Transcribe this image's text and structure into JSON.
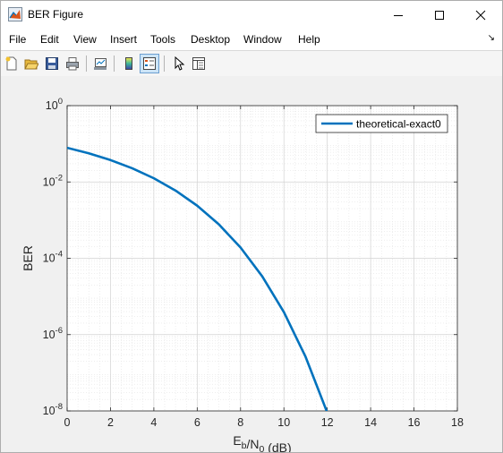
{
  "window": {
    "title": "BER Figure"
  },
  "menu": [
    "File",
    "Edit",
    "View",
    "Insert",
    "Tools",
    "Desktop",
    "Window",
    "Help"
  ],
  "toolbar": {
    "buttons": [
      {
        "icon": "new-figure-icon"
      },
      {
        "icon": "open-file-icon"
      },
      {
        "icon": "save-icon"
      },
      {
        "icon": "print-icon"
      },
      {
        "icon": "link-plot-icon"
      },
      {
        "icon": "colorbar-icon"
      },
      {
        "icon": "legend-icon",
        "pressed": true
      },
      {
        "icon": "pointer-icon"
      },
      {
        "icon": "property-inspector-icon"
      }
    ]
  },
  "chart_data": {
    "type": "line",
    "title": "",
    "xlabel": "E_b/N_0 (dB)",
    "ylabel": "BER",
    "xlim": [
      0,
      18
    ],
    "ylim": [
      1e-08,
      1
    ],
    "yscale": "log",
    "xticks": [
      "0",
      "2",
      "4",
      "6",
      "8",
      "10",
      "12",
      "14",
      "16",
      "18"
    ],
    "yticks": [
      "10^0",
      "10^-2",
      "10^-4",
      "10^-6",
      "10^-8"
    ],
    "grid": true,
    "minor_grid": true,
    "legend_position": "top-right",
    "series": [
      {
        "name": "theoretical-exact0",
        "color": "#0072bd",
        "x": [
          0,
          1,
          2,
          3,
          4,
          5,
          6,
          7,
          8,
          9,
          10,
          11,
          12
        ],
        "y": [
          0.0786,
          0.0563,
          0.0375,
          0.0229,
          0.0125,
          0.00595,
          0.00239,
          0.000773,
          0.000191,
          3.36e-05,
          3.87e-06,
          2.61e-07,
          9e-09
        ]
      }
    ]
  }
}
